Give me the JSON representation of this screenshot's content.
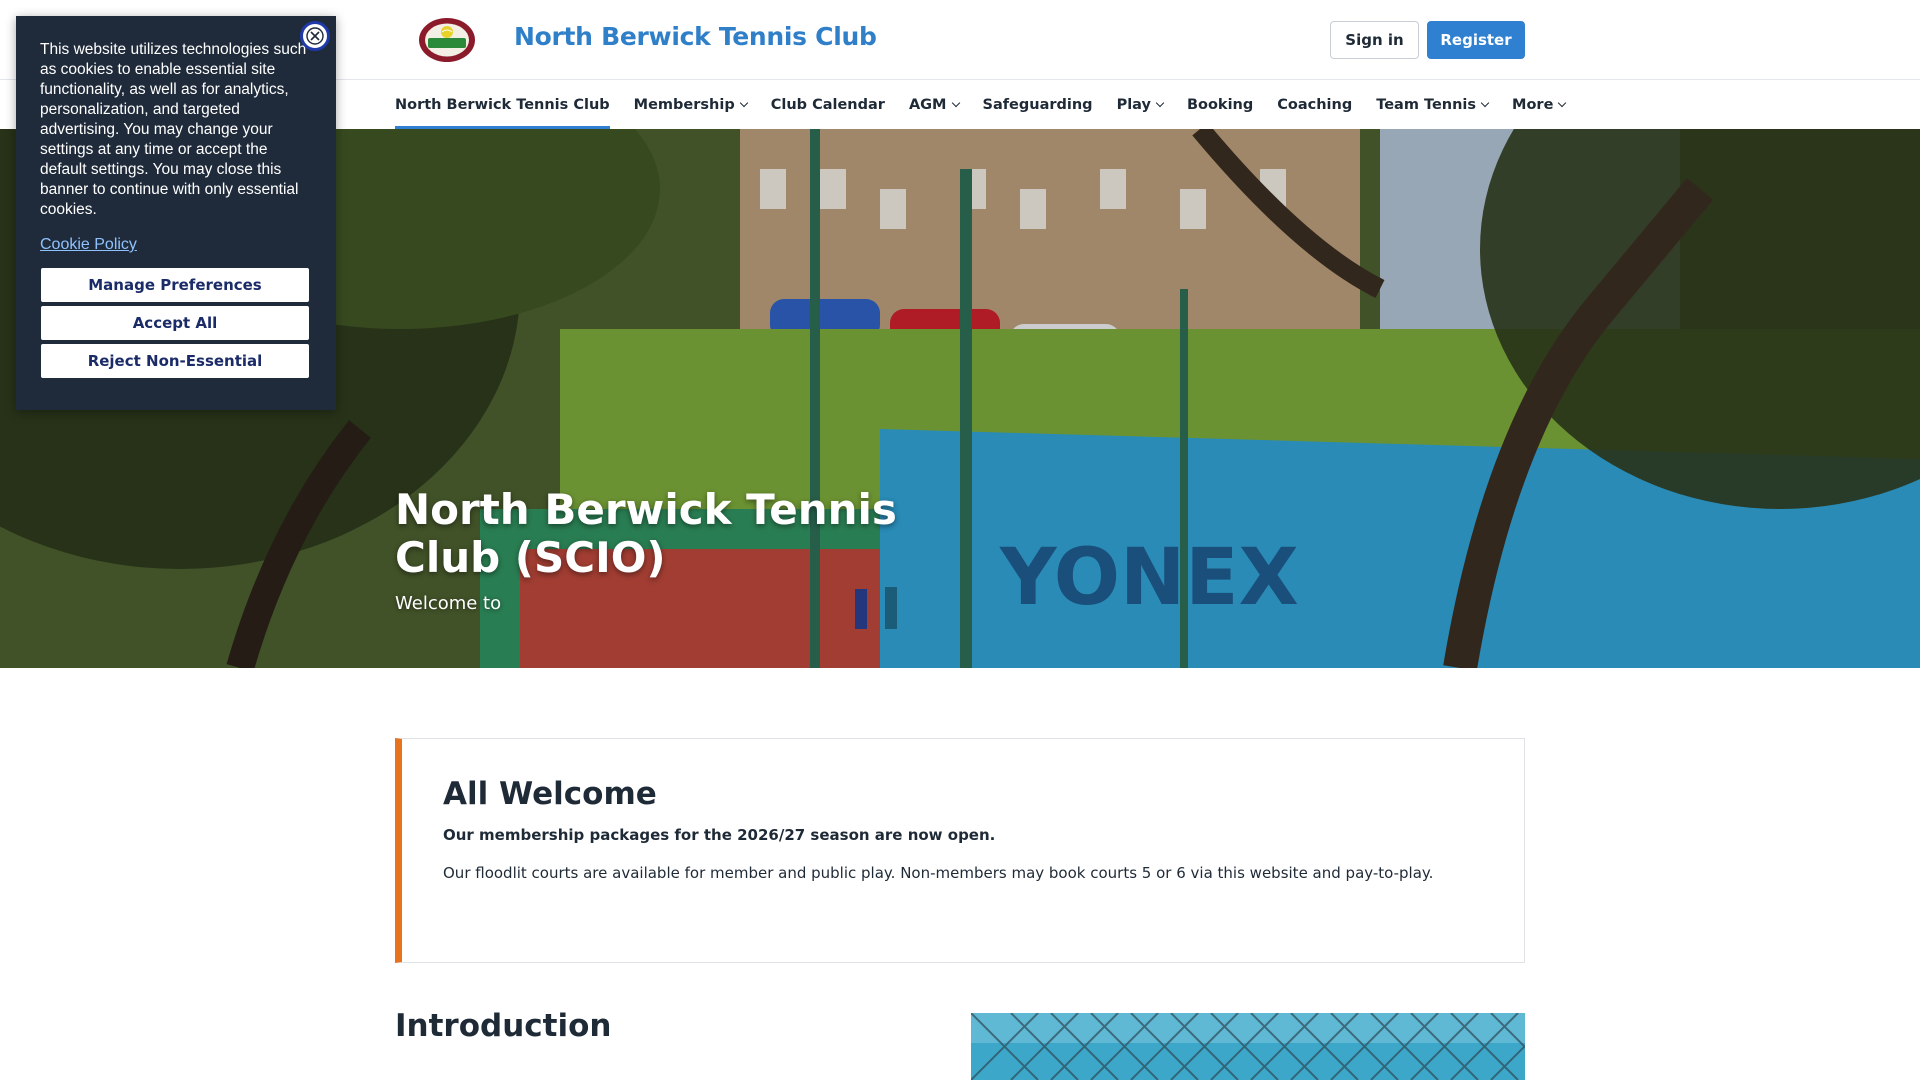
{
  "header": {
    "club_name": "North Berwick Tennis Club",
    "sign_in_label": "Sign in",
    "register_label": "Register",
    "logo_alt": "North Berwick Tennis Club logo"
  },
  "nav": {
    "items": [
      {
        "label": "North Berwick Tennis Club",
        "active": true,
        "dropdown": false
      },
      {
        "label": "Membership",
        "active": false,
        "dropdown": true
      },
      {
        "label": "Club Calendar",
        "active": false,
        "dropdown": false
      },
      {
        "label": "AGM",
        "active": false,
        "dropdown": true
      },
      {
        "label": "Safeguarding",
        "active": false,
        "dropdown": false
      },
      {
        "label": "Play",
        "active": false,
        "dropdown": true
      },
      {
        "label": "Booking",
        "active": false,
        "dropdown": false
      },
      {
        "label": "Coaching",
        "active": false,
        "dropdown": false
      },
      {
        "label": "Team Tennis",
        "active": false,
        "dropdown": true
      },
      {
        "label": "More",
        "active": false,
        "dropdown": true
      }
    ]
  },
  "hero": {
    "title": "North Berwick Tennis Club (SCIO)",
    "subtitle": "Welcome to",
    "banner_text": "YONEX"
  },
  "cookie_banner": {
    "text": "This website utilizes technologies such as cookies to enable essential site functionality, as well as for analytics, personalization, and targeted advertising. You may change your settings at any time or accept the default settings. You may close this banner to continue with only essential cookies.",
    "policy_link": "Cookie Policy",
    "manage_label": "Manage Preferences",
    "accept_label": "Accept All",
    "reject_label": "Reject Non-Essential"
  },
  "welcome": {
    "title": "All Welcome",
    "bold_text": "Our membership packages for the 2026/27 season are now open.",
    "text": "Our floodlit courts are available for member and public play. Non-members may book courts 5 or 6 via this website and pay-to-play."
  },
  "intro": {
    "title": "Introduction"
  },
  "colors": {
    "brand_blue": "#2f80d1",
    "accent_orange": "#e8731f",
    "banner_bg": "#1f2b3a"
  }
}
